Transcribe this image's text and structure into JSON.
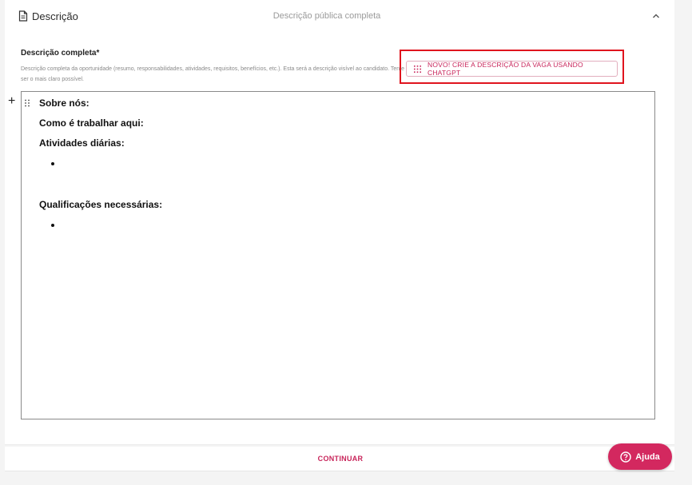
{
  "section": {
    "title": "Descrição",
    "subtitle": "Descrição pública completa"
  },
  "field": {
    "label": "Descrição completa*",
    "help": "Descrição completa da oportunidade (resumo, responsabilidades, atividades, requisitos, benefícios, etc.). Esta será a descrição visível ao candidato. Tente ser o mais claro possível."
  },
  "gpt_button": {
    "label": "NOVO! CRIE A DESCRIÇÃO DA VAGA USANDO CHATGPT"
  },
  "editor": {
    "blocks": [
      "Sobre nós:",
      "Como é trabalhar aqui:",
      "Atividades diárias:",
      "Qualificações necessárias:"
    ]
  },
  "footer": {
    "continue_label": "CONTINUAR"
  },
  "help_button": {
    "label": "Ajuda"
  },
  "colors": {
    "accent": "#d3285f",
    "highlight": "#e0141e"
  },
  "icons": {
    "section": "document-icon",
    "collapse": "chevron-up-icon",
    "gpt": "grid-icon",
    "add": "plus-icon",
    "drag": "drag-handle-icon",
    "help": "question-circle-icon"
  }
}
